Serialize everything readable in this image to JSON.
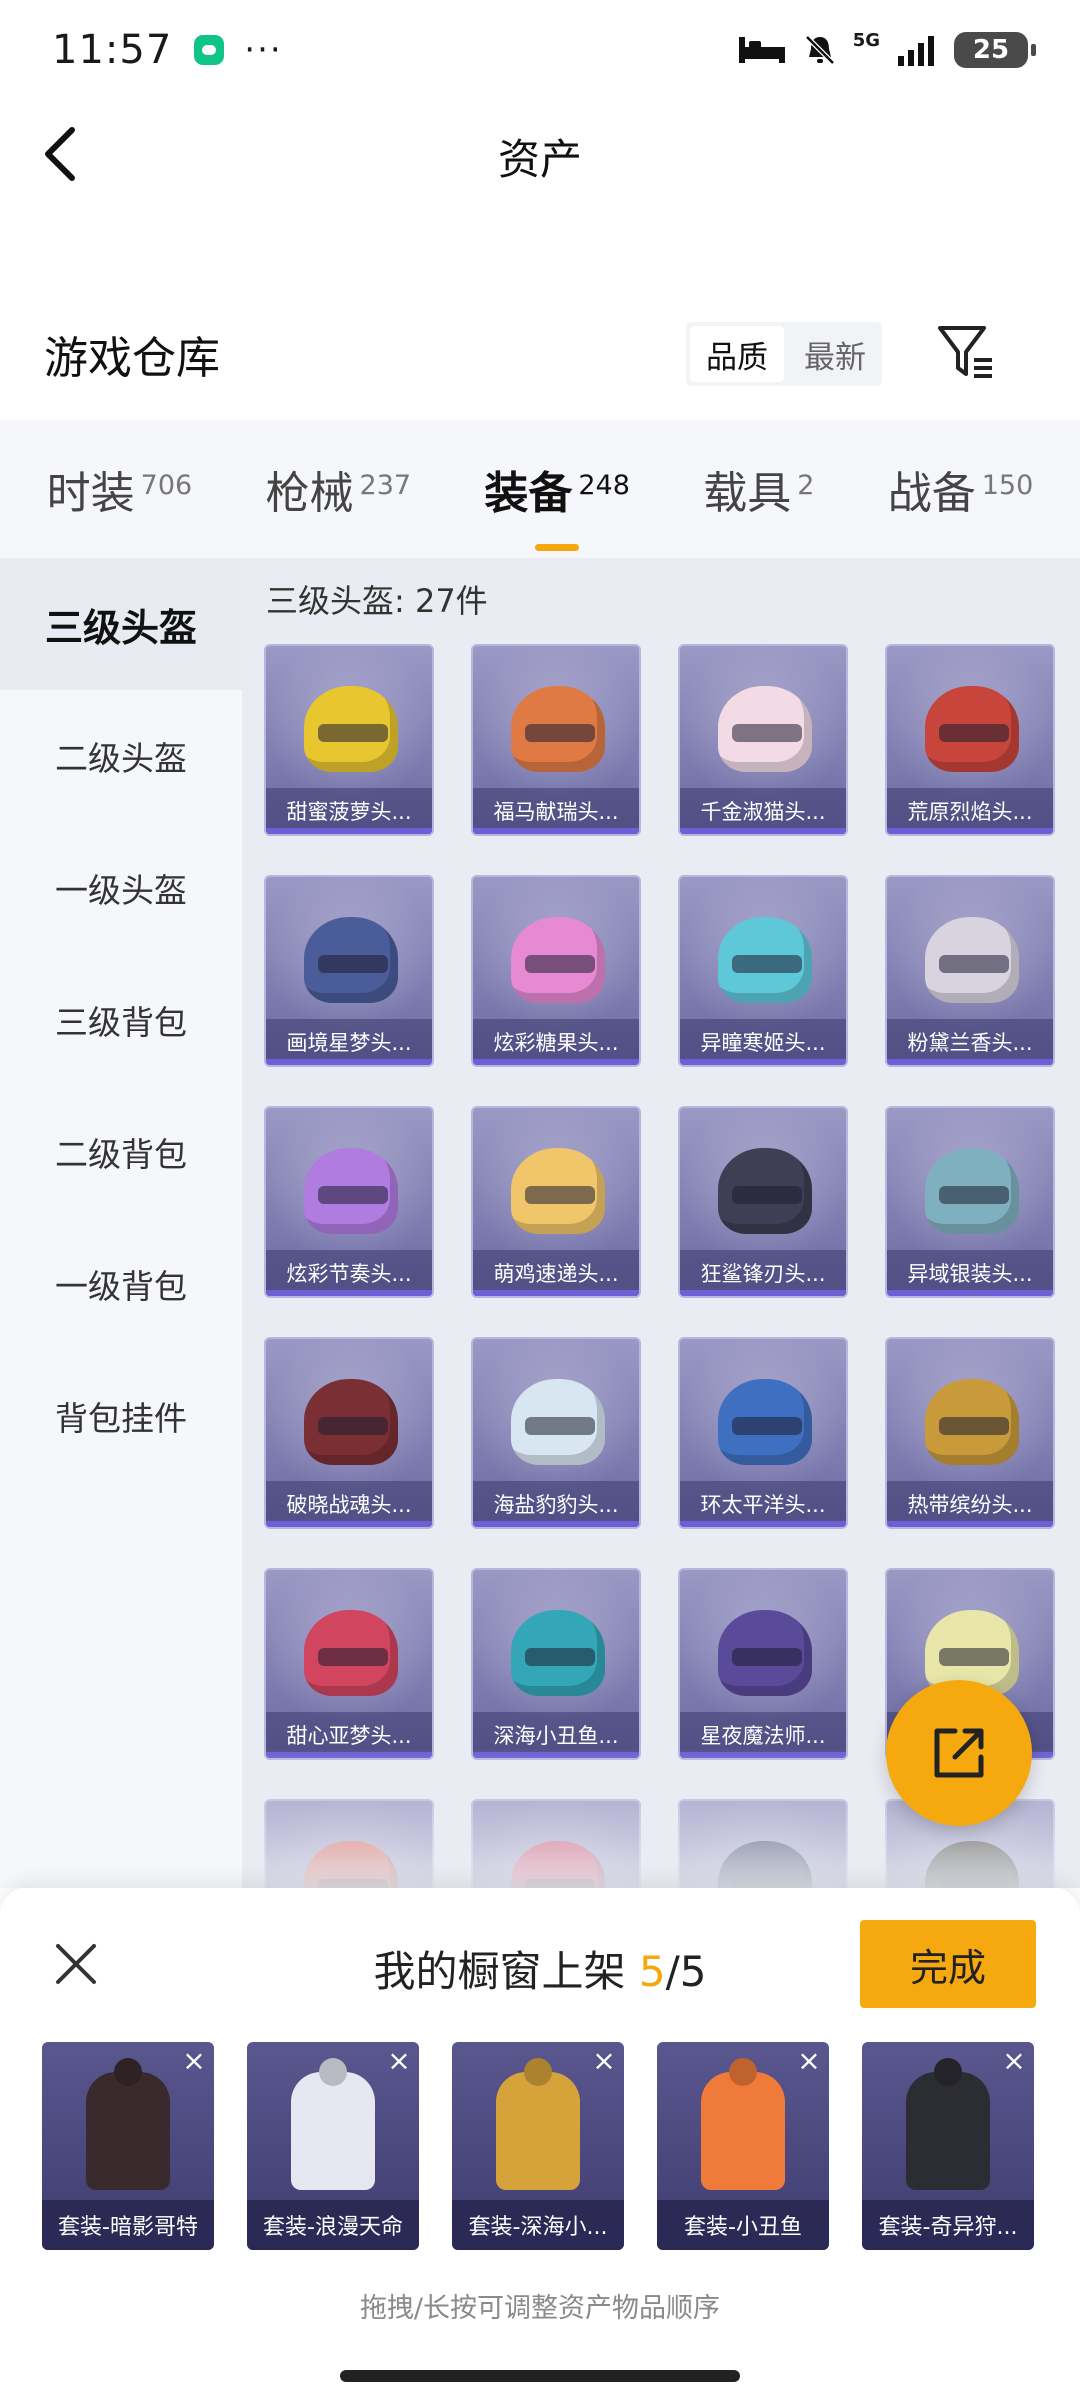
{
  "status_bar": {
    "time": "11:57",
    "dots": "···",
    "network": "5G",
    "battery": "25"
  },
  "header": {
    "back_icon": "chevron-left-icon",
    "title": "资产"
  },
  "warehouse": {
    "title": "游戏仓库",
    "sort_options": [
      "品质",
      "最新"
    ],
    "active_sort": "品质",
    "filter_icon": "filter-icon"
  },
  "tabs": [
    {
      "label": "时装",
      "count": "706",
      "active": false
    },
    {
      "label": "枪械",
      "count": "237",
      "active": false
    },
    {
      "label": "装备",
      "count": "248",
      "active": true
    },
    {
      "label": "载具",
      "count": "2",
      "active": false
    },
    {
      "label": "战备",
      "count": "150",
      "active": false
    }
  ],
  "sidebar": {
    "items": [
      "三级头盔",
      "二级头盔",
      "一级头盔",
      "三级背包",
      "二级背包",
      "一级背包",
      "背包挂件"
    ],
    "active_index": 0
  },
  "content": {
    "section_label": "三级头盔: 27件",
    "items": [
      {
        "name": "甜蜜菠萝头...",
        "color": "#e8c630"
      },
      {
        "name": "福马献瑞头...",
        "color": "#e07a45"
      },
      {
        "name": "千金淑猫头...",
        "color": "#f3dbe6"
      },
      {
        "name": "荒原烈焰头...",
        "color": "#c8453b"
      },
      {
        "name": "画境星梦头...",
        "color": "#4a5c9a"
      },
      {
        "name": "炫彩糖果头...",
        "color": "#e68ad3"
      },
      {
        "name": "异瞳寒姬头...",
        "color": "#5ec7d8"
      },
      {
        "name": "粉黛兰香头...",
        "color": "#d9d3e0"
      },
      {
        "name": "炫彩节奏头...",
        "color": "#b07ce0"
      },
      {
        "name": "萌鸡速递头...",
        "color": "#f1c56a"
      },
      {
        "name": "狂鲨锋刃头...",
        "color": "#3e3e55"
      },
      {
        "name": "异域银装头...",
        "color": "#7fb0c0"
      },
      {
        "name": "破晓战魂头...",
        "color": "#7a2f35"
      },
      {
        "name": "海盐豹豹头...",
        "color": "#d8e6f2"
      },
      {
        "name": "环太平洋头...",
        "color": "#3f6fc0"
      },
      {
        "name": "热带缤纷头...",
        "color": "#c89a3a"
      },
      {
        "name": "甜心亚梦头...",
        "color": "#d1455e"
      },
      {
        "name": "深海小丑鱼...",
        "color": "#33a6b8"
      },
      {
        "name": "星夜魔法师...",
        "color": "#5a4a9a"
      },
      {
        "name": "",
        "color": "#e8e6a8"
      },
      {
        "name": "",
        "color": "#e05a4e"
      },
      {
        "name": "",
        "color": "#d64a6a"
      },
      {
        "name": "",
        "color": "#2f3a5e"
      },
      {
        "name": "",
        "color": "#3a3530"
      }
    ]
  },
  "fab": {
    "icon": "share-icon"
  },
  "showcase": {
    "close_icon": "close-icon",
    "title_prefix": "我的橱窗上架",
    "count_current": "5",
    "count_sep": "/5",
    "done_label": "完成",
    "items": [
      {
        "name": "套装-暗影哥特",
        "color": "#3a2a2e"
      },
      {
        "name": "套装-浪漫天命",
        "color": "#e7e7f2"
      },
      {
        "name": "套装-深海小...",
        "color": "#d6a23a"
      },
      {
        "name": "套装-小丑鱼",
        "color": "#f07a3a"
      },
      {
        "name": "套装-奇异狩...",
        "color": "#2c2c33"
      }
    ],
    "remove_glyph": "×",
    "hint": "拖拽/长按可调整资产物品顺序"
  }
}
